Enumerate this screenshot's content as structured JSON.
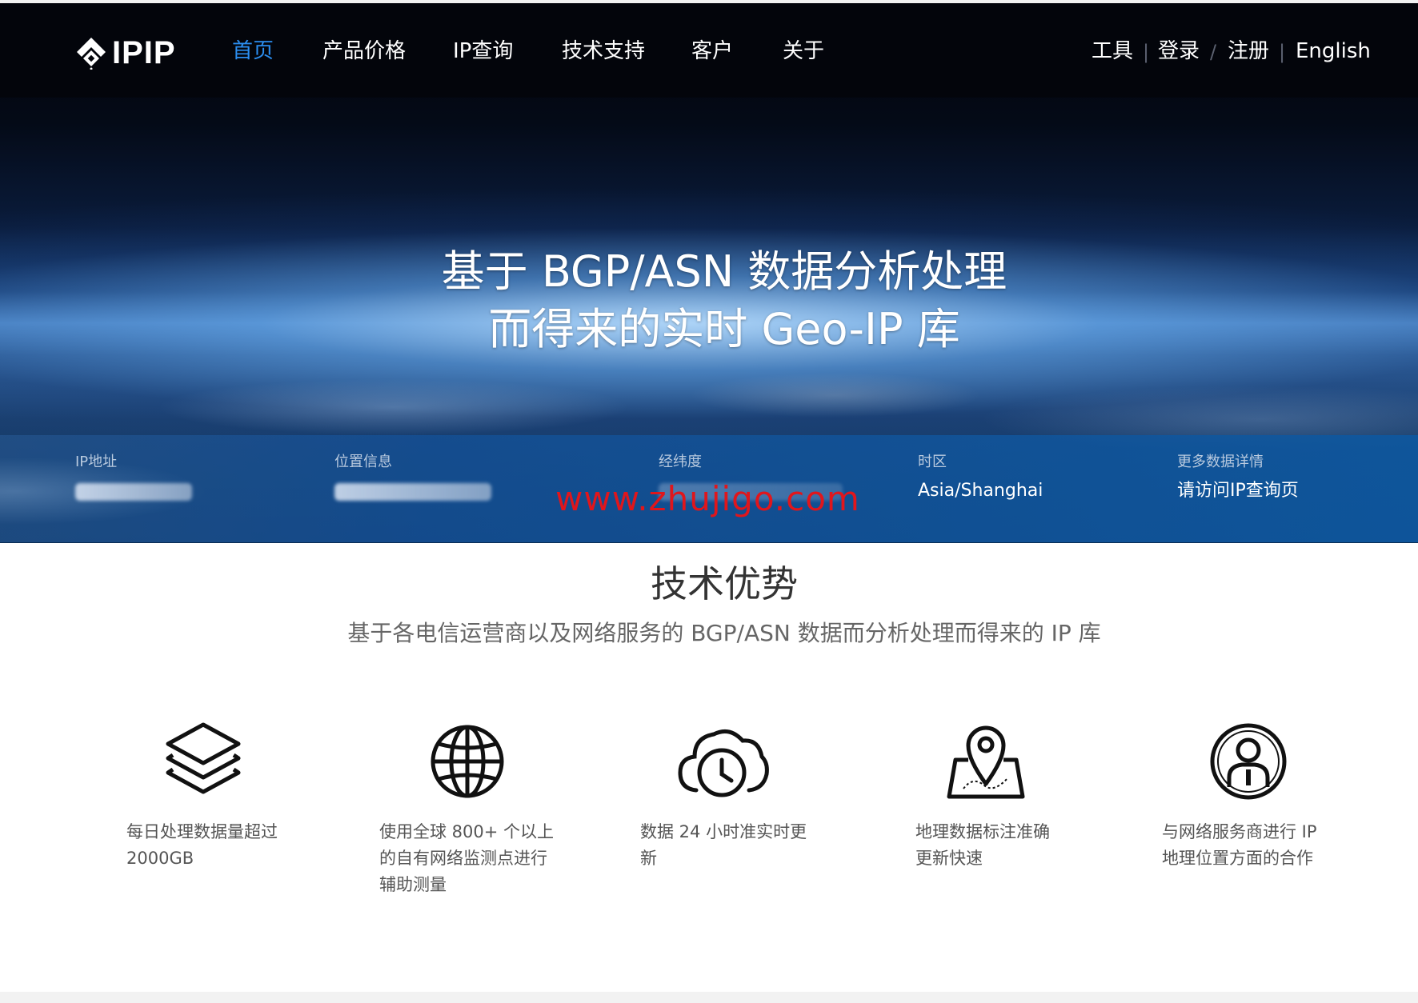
{
  "nav": {
    "logo_text": "IPIP",
    "items": [
      {
        "label": "首页",
        "active": true
      },
      {
        "label": "产品价格",
        "active": false
      },
      {
        "label": "IP查询",
        "active": false
      },
      {
        "label": "技术支持",
        "active": false
      },
      {
        "label": "客户",
        "active": false
      },
      {
        "label": "关于",
        "active": false
      }
    ],
    "right": {
      "tools": "工具",
      "login": "登录",
      "register": "注册",
      "english": "English",
      "sep_bar": "|",
      "sep_slash": "/"
    },
    "active_color": "#2b8ef0"
  },
  "hero": {
    "title_line1": "基于 BGP/ASN 数据分析处理",
    "title_line2": "而得来的实时 Geo-IP 库"
  },
  "info_bar": {
    "ip_label": "IP地址",
    "location_label": "位置信息",
    "coords_label": "经纬度",
    "timezone_label": "时区",
    "timezone_value": "Asia/Shanghai",
    "more_label": "更多数据详情",
    "more_link": "请访问IP查询页"
  },
  "watermark": "www.zhujigo.com",
  "features_section": {
    "title": "技术优势",
    "subtitle": "基于各电信运营商以及网络服务的 BGP/ASN 数据而分析处理而得来的 IP 库",
    "items": [
      {
        "icon": "layers-icon",
        "lines": [
          "每日处理数据量超过",
          "2000GB"
        ]
      },
      {
        "icon": "globe-icon",
        "lines": [
          "使用全球 800+ 个以上",
          "的自有网络监测点进行",
          "辅助测量"
        ]
      },
      {
        "icon": "cloud-clock-icon",
        "lines": [
          "数据 24 小时准实时更",
          "新"
        ]
      },
      {
        "icon": "map-pin-icon",
        "lines": [
          "地理数据标注准确",
          "更新快速"
        ]
      },
      {
        "icon": "person-circle-icon",
        "lines": [
          "与网络服务商进行 IP",
          "地理位置方面的合作"
        ]
      }
    ]
  },
  "colors": {
    "watermark": "#e0161c",
    "nav_background": "#03050b",
    "info_bar": "#0e58a0"
  }
}
